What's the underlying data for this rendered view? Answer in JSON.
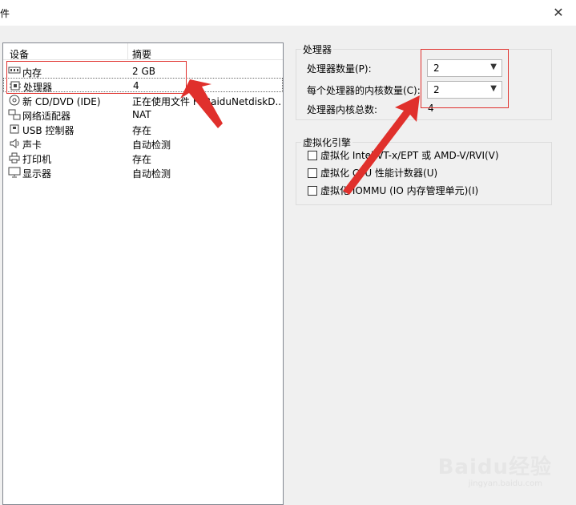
{
  "window": {
    "title": "件",
    "close_glyph": "✕"
  },
  "device_list": {
    "headers": {
      "device": "设备",
      "summary": "摘要"
    },
    "rows": [
      {
        "name": "内存",
        "summary": "2 GB",
        "icon": "memory-icon"
      },
      {
        "name": "处理器",
        "summary": "4",
        "icon": "processor-icon"
      },
      {
        "name": "新 CD/DVD (IDE)",
        "summary": "正在使用文件 F:\\BaiduNetdiskD...",
        "icon": "cd-dvd-icon"
      },
      {
        "name": "网络适配器",
        "summary": "NAT",
        "icon": "network-adapter-icon"
      },
      {
        "name": "USB 控制器",
        "summary": "存在",
        "icon": "usb-icon"
      },
      {
        "name": "声卡",
        "summary": "自动检测",
        "icon": "sound-card-icon"
      },
      {
        "name": "打印机",
        "summary": "存在",
        "icon": "printer-icon"
      },
      {
        "name": "显示器",
        "summary": "自动检测",
        "icon": "display-icon"
      }
    ]
  },
  "processor_group": {
    "title": "处理器",
    "count_label": "处理器数量(P):",
    "count_value": "2",
    "cores_label": "每个处理器的内核数量(C):",
    "cores_value": "2",
    "total_label": "处理器内核总数:",
    "total_value": "4"
  },
  "virtualization_group": {
    "title": "虚拟化引擎",
    "options": [
      "虚拟化 Intel VT-x/EPT 或 AMD-V/RVI(V)",
      "虚拟化 CPU 性能计数器(U)",
      "虚拟化 IOMMU (IO 内存管理单元)(I)"
    ]
  },
  "watermark": {
    "brand": "Baidu经验",
    "url": "jingyan.baidu.com"
  },
  "colors": {
    "annotation": "#e0302c"
  }
}
